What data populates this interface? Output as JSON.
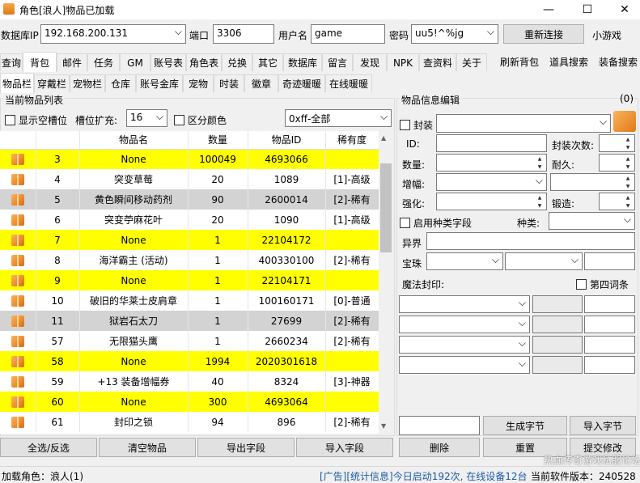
{
  "window": {
    "title": "角色[浪人]物品已加载",
    "min_glyph": "—",
    "max_glyph": "☐",
    "close_glyph": "✕"
  },
  "conn": {
    "ip_label": "数据库IP",
    "ip_value": "192.168.200.131",
    "port_label": "端口",
    "port_value": "3306",
    "user_label": "用户名",
    "user_value": "game",
    "pwd_label": "密码",
    "pwd_value": "uu5!^%jg",
    "reconnect_label": "重新连接",
    "minigame_label": "小游戏"
  },
  "main_tabs": [
    "查询",
    "背包",
    "邮件",
    "任务",
    "GM",
    "账号表",
    "角色表",
    "兑换",
    "其它",
    "数据库",
    "留言",
    "发现",
    "NPK",
    "查资料",
    "关于"
  ],
  "actions": {
    "refresh_bag": "刷新背包",
    "item_search": "道具搜索",
    "equip_search": "装备搜索"
  },
  "sub_tabs": [
    "物品栏",
    "穿戴栏",
    "宠物栏",
    "仓库",
    "账号金库",
    "宠物",
    "时装",
    "徽章",
    "奇迹暖暖",
    "在线暖暖"
  ],
  "list": {
    "group_title": "当前物品列表",
    "show_empty_label": "显示空槽位",
    "slot_expand_label": "槽位扩充:",
    "slot_expand_value": "16",
    "color_label": "区分颜色",
    "filter_value": "0xff-全部",
    "headers": [
      "",
      "",
      "物品名",
      "数量",
      "物品ID",
      "稀有度"
    ],
    "rows": [
      {
        "slot": "3",
        "name": "None",
        "qty": "100049",
        "id": "4693066",
        "rarity": "",
        "bg": "#ffff00"
      },
      {
        "slot": "4",
        "name": "突变草莓",
        "qty": "20",
        "id": "1089",
        "rarity": "[1]-高级",
        "bg": "#ffffff"
      },
      {
        "slot": "5",
        "name": "黄色瞬间移动药剂",
        "qty": "90",
        "id": "2600014",
        "rarity": "[2]-稀有",
        "bg": "#d3d3d3"
      },
      {
        "slot": "6",
        "name": "突变苧麻花叶",
        "qty": "20",
        "id": "1090",
        "rarity": "[1]-高级",
        "bg": "#ffffff"
      },
      {
        "slot": "7",
        "name": "None",
        "qty": "1",
        "id": "22104172",
        "rarity": "",
        "bg": "#ffff00"
      },
      {
        "slot": "8",
        "name": "海洋霸主 (活动)",
        "qty": "1",
        "id": "400330100",
        "rarity": "[2]-稀有",
        "bg": "#ffffff"
      },
      {
        "slot": "9",
        "name": "None",
        "qty": "1",
        "id": "22104171",
        "rarity": "",
        "bg": "#ffff00"
      },
      {
        "slot": "10",
        "name": "破旧的华莱士皮肩章",
        "qty": "1",
        "id": "100160171",
        "rarity": "[0]-普通",
        "bg": "#ffffff"
      },
      {
        "slot": "11",
        "name": "狱岩石太刀",
        "qty": "1",
        "id": "27699",
        "rarity": "[2]-稀有",
        "bg": "#d3d3d3"
      },
      {
        "slot": "57",
        "name": "无限猫头鹰",
        "qty": "1",
        "id": "2660234",
        "rarity": "[2]-稀有",
        "bg": "#ffffff"
      },
      {
        "slot": "58",
        "name": "None",
        "qty": "1994",
        "id": "2020301618",
        "rarity": "",
        "bg": "#ffff00"
      },
      {
        "slot": "59",
        "name": "+13 装备增幅券",
        "qty": "40",
        "id": "8324",
        "rarity": "[3]-神器",
        "bg": "#ffffff"
      },
      {
        "slot": "60",
        "name": "None",
        "qty": "300",
        "id": "4693064",
        "rarity": "",
        "bg": "#ffff00"
      },
      {
        "slot": "61",
        "name": "封印之锁",
        "qty": "94",
        "id": "896",
        "rarity": "[2]-稀有",
        "bg": "#ffffff"
      }
    ],
    "buttons": [
      "全选/反选",
      "清空物品",
      "导出字段",
      "导入字段"
    ]
  },
  "editor": {
    "group_title": "物品信息编辑",
    "count": "(0)",
    "seal_label": "封装",
    "id_label": "ID:",
    "seal_count_label": "封装次数:",
    "qty_label": "数量:",
    "durability_label": "耐久:",
    "amplify_label": "增幅:",
    "enhance_label": "强化:",
    "forge_label": "锻造:",
    "enable_type_label": "启用种类字段",
    "type_label": "种类:",
    "otherworld_label": "异界",
    "orb_label": "宝珠",
    "magic_seal_label": "魔法封印:",
    "fourth_affix_label": "第四词条",
    "gen_bytes_label": "生成字节",
    "import_bytes_label": "导入字节",
    "delete_label": "删除",
    "reset_label": "重置",
    "submit_label": "提交修改"
  },
  "status": {
    "loaded_text": "加载角色：浪人(1)",
    "ad_text": "[广告][统计信息]今日启动192次, 在线设备12台",
    "version_text": "当前软件版本：240528",
    "watermark": "热血传奇游戏私服论坛"
  },
  "colors": {
    "accent_yellow": "#ffff00",
    "row_gray": "#d3d3d3",
    "icon_orange": "#ee8a2a",
    "link_blue": "#1a5aa8"
  },
  "icons": {
    "app": "package-icon",
    "item": "box-icon"
  }
}
